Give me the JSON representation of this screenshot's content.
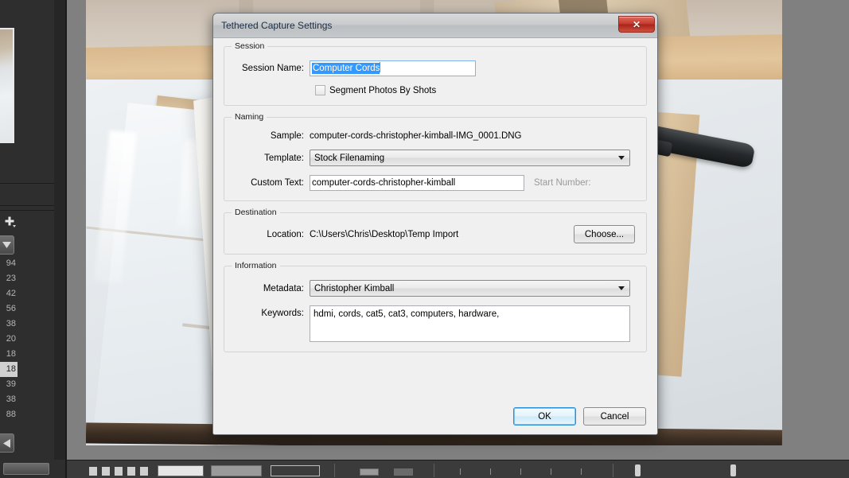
{
  "dialog": {
    "title": "Tethered Capture Settings",
    "close_icon": "close-x-icon",
    "groups": {
      "session": {
        "legend": "Session",
        "session_name_label": "Session Name:",
        "session_name_value": "Computer Cords",
        "segment_checkbox_label": "Segment Photos By Shots",
        "segment_checked": false
      },
      "naming": {
        "legend": "Naming",
        "sample_label": "Sample:",
        "sample_value": "computer-cords-christopher-kimball-IMG_0001.DNG",
        "template_label": "Template:",
        "template_value": "Stock Filenaming",
        "custom_text_label": "Custom Text:",
        "custom_text_value": "computer-cords-christopher-kimball",
        "start_number_label": "Start Number:",
        "start_number_value": ""
      },
      "destination": {
        "legend": "Destination",
        "location_label": "Location:",
        "location_value": "C:\\Users\\Chris\\Desktop\\Temp Import",
        "choose_button": "Choose..."
      },
      "information": {
        "legend": "Information",
        "metadata_label": "Metadata:",
        "metadata_value": "Christopher Kimball",
        "keywords_label": "Keywords:",
        "keywords_value": "hdmi, cords, cat5, cat3, computers, hardware,"
      }
    },
    "ok_button": "OK",
    "cancel_button": "Cancel"
  },
  "app": {
    "filmstrip_numbers": [
      "94",
      "23",
      "42",
      "56",
      "38",
      "20",
      "18",
      "18",
      "39",
      "38",
      "88"
    ],
    "selected_number_index": 7,
    "add_icon": "plus-icon",
    "dropdown_icon": "chevron-down-icon",
    "back_icon": "triangle-left-icon"
  },
  "colors": {
    "accent_blue": "#3399ff",
    "focus_blue": "#2a8fd4",
    "close_red": "#c23a2c",
    "dialog_bg": "#f0f0f0",
    "app_bg": "#808080",
    "panel_dark": "#2e2e2e"
  }
}
